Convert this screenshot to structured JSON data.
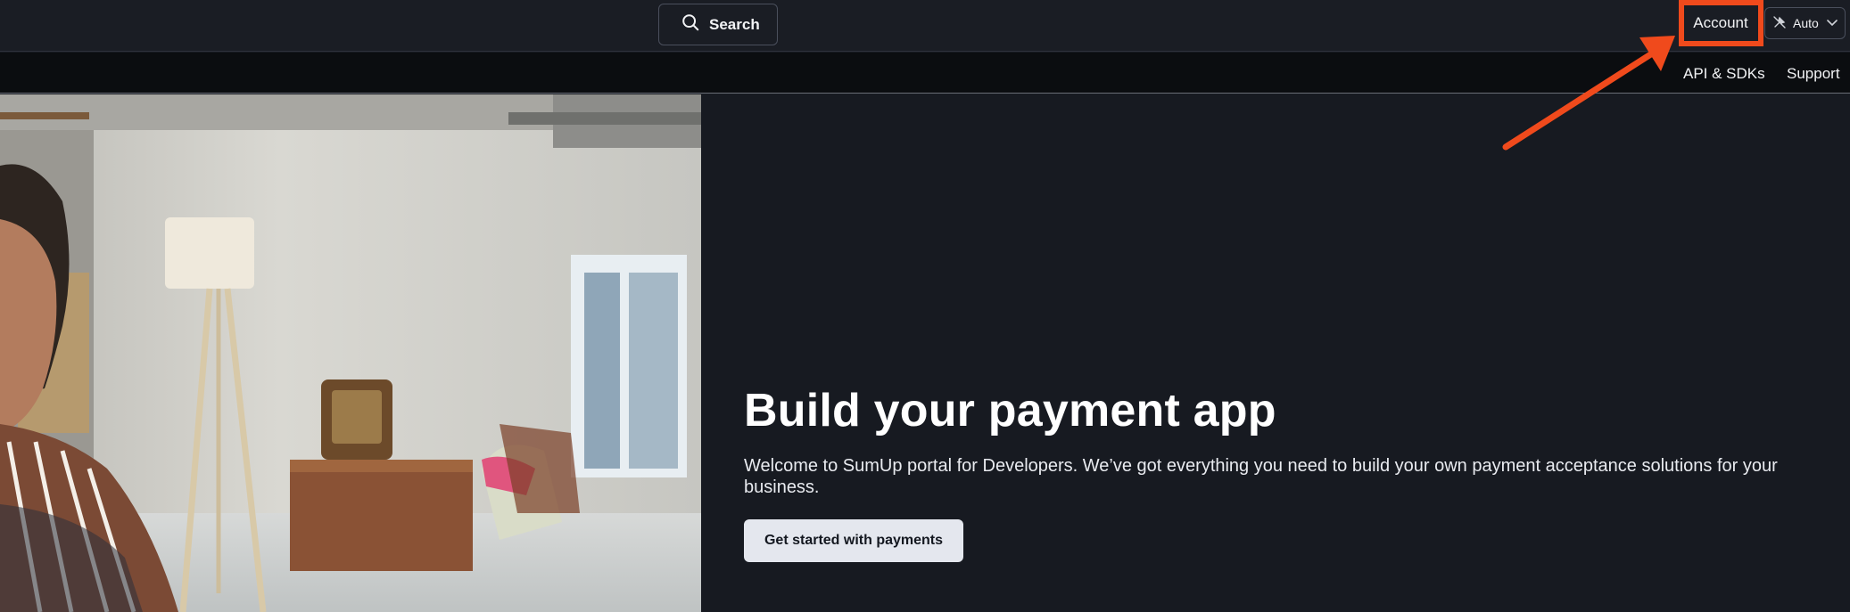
{
  "header": {
    "search_label": "Search",
    "search_icon": "search-icon",
    "account_label": "Account",
    "theme": {
      "value": "Auto",
      "icon": "auto-theme-icon",
      "chevron": "chevron-down-icon"
    }
  },
  "subnav": {
    "items": [
      {
        "label": "API & SDKs"
      },
      {
        "label": "Support"
      }
    ]
  },
  "hero": {
    "title": "Build your payment app",
    "description": "Welcome to SumUp portal for Developers. We’ve got everything you need to build your own payment acceptance solutions for your business.",
    "cta_label": "Get started with payments"
  },
  "annotation": {
    "color": "#f04a1c"
  },
  "colors": {
    "background": "#171a21",
    "topbar": "#1a1d24",
    "subnav": "#0b0d10",
    "cta_bg": "#e4e7ee"
  }
}
